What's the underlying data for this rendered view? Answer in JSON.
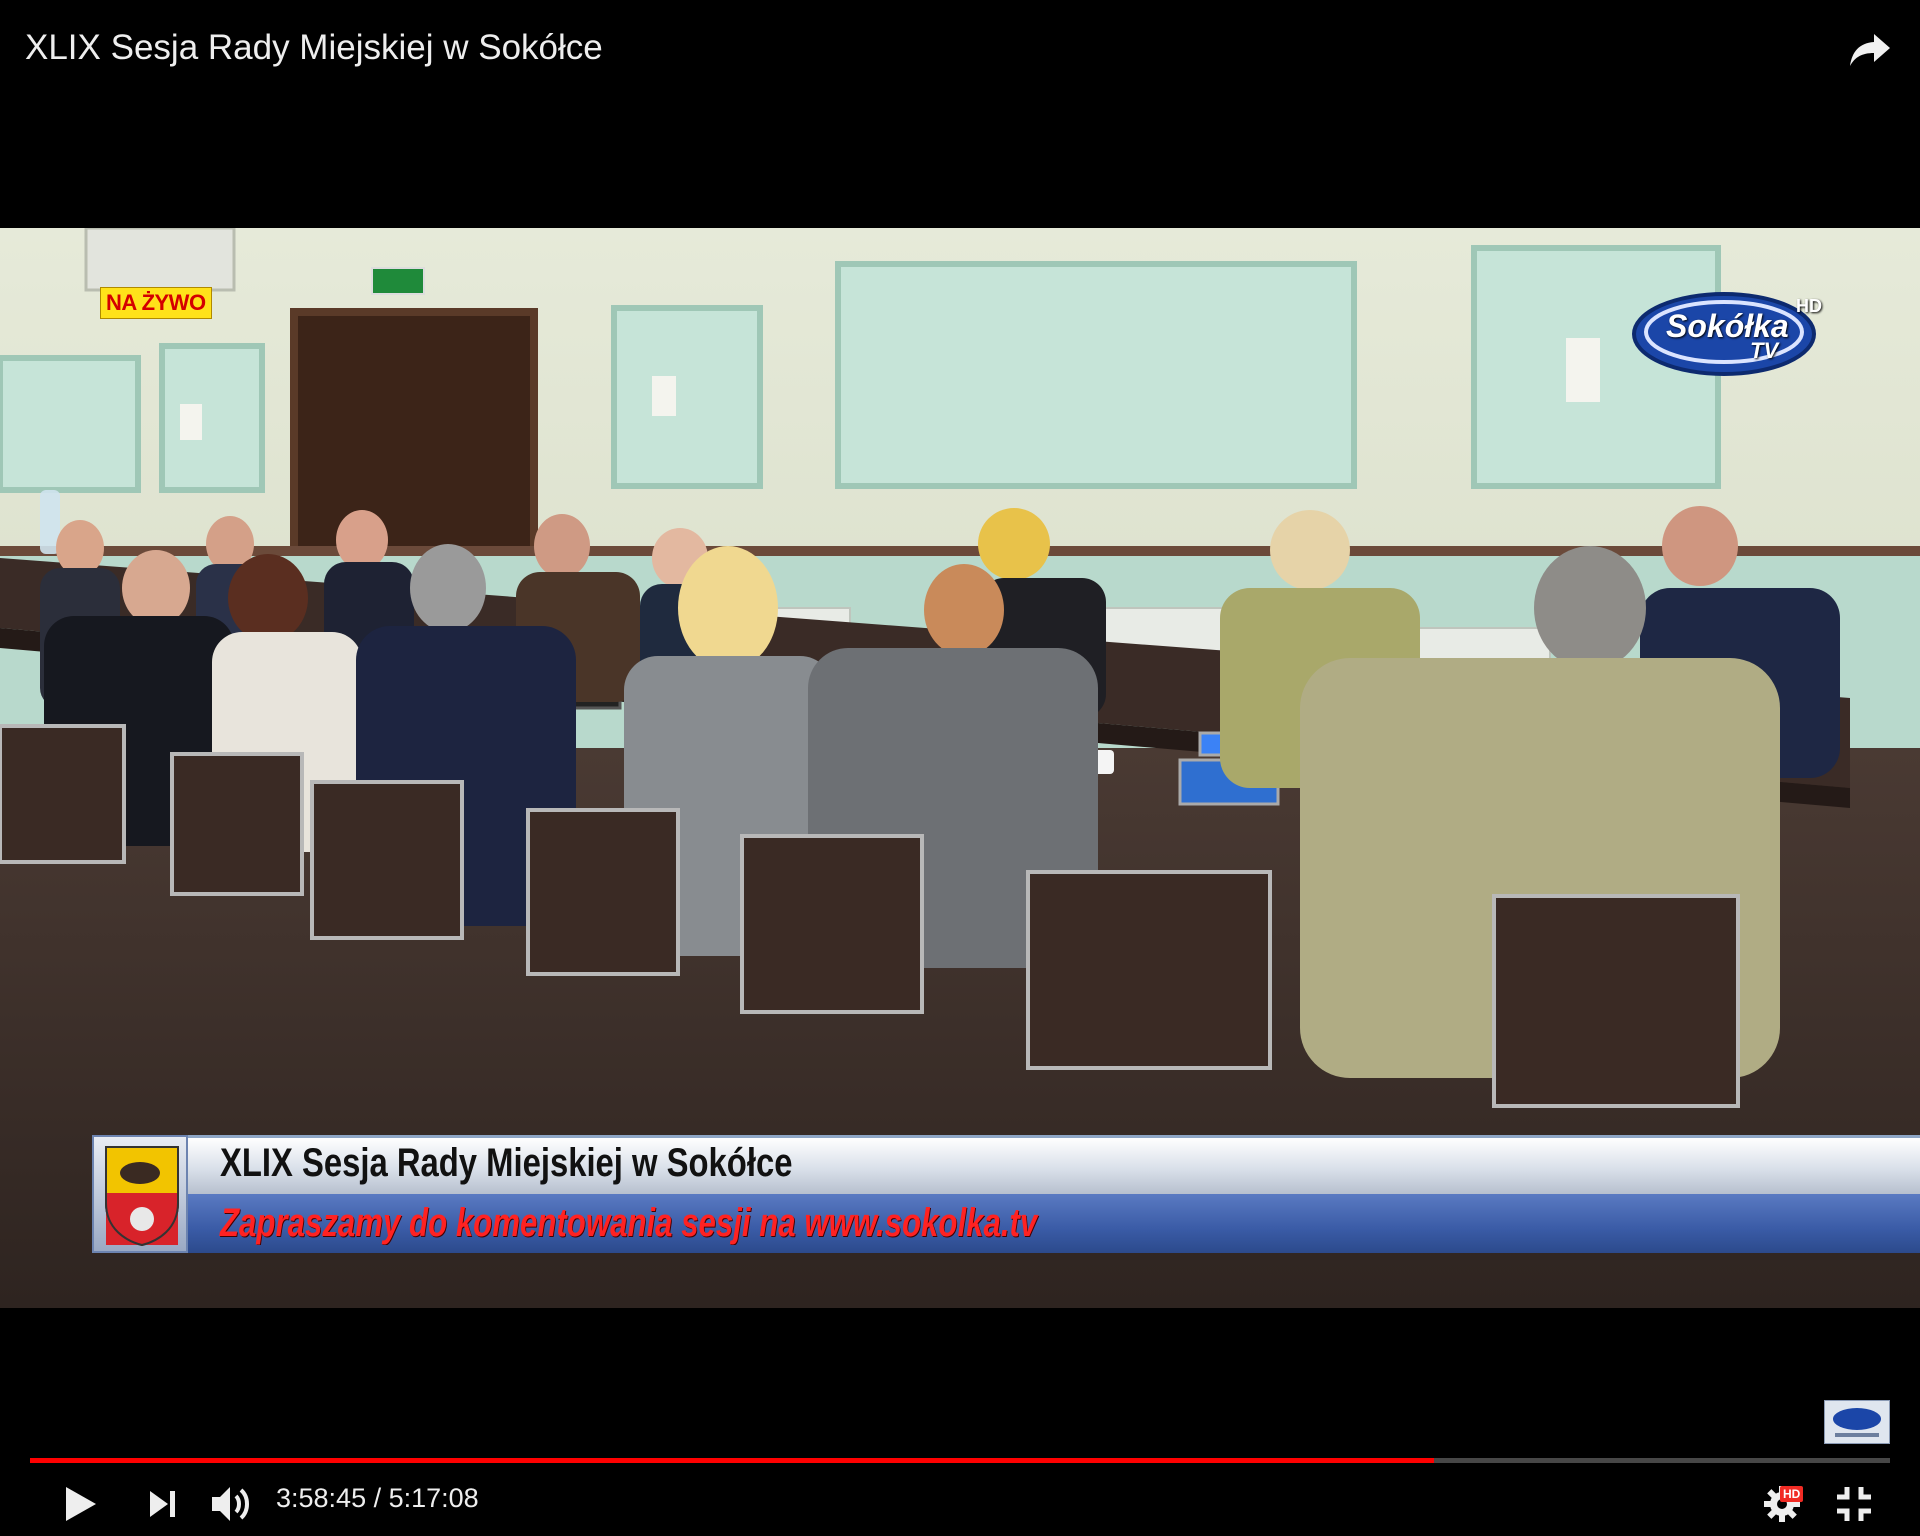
{
  "player": {
    "video_title": "XLIX Sesja Rady Miejskiej w Sokółce",
    "current_time": "3:58:45",
    "duration": "5:17:08",
    "time_separator": " / ",
    "progress_fraction": 0.755,
    "hd_label": "HD",
    "accent_color": "#ff0000"
  },
  "overlay": {
    "live_badge": "NA ŻYWO",
    "channel_logo": {
      "name": "Sokółka",
      "sub": "TV",
      "hd": "HD"
    },
    "lower_third": {
      "title": "XLIX Sesja Rady Miejskiej w Sokółce",
      "subtitle": "Zapraszamy do komentowania sesji na www.sokolka.tv"
    }
  },
  "icons": {
    "share": "share-arrow-icon",
    "play": "play-icon",
    "next": "skip-next-icon",
    "volume": "volume-icon",
    "settings": "gear-icon",
    "fullscreen": "exit-fullscreen-icon"
  }
}
